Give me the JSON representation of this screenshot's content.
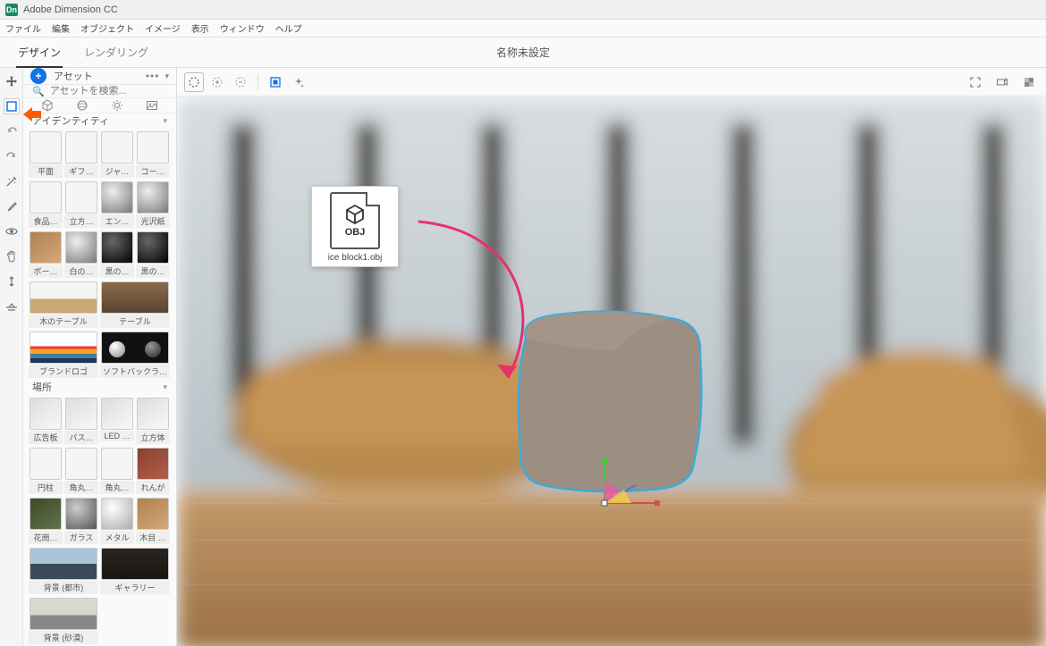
{
  "app": {
    "title": "Adobe Dimension CC",
    "icon_label": "Dn"
  },
  "menubar": [
    "ファイル",
    "編集",
    "オブジェクト",
    "イメージ",
    "表示",
    "ウィンドウ",
    "ヘルプ"
  ],
  "tabs": {
    "design": "デザイン",
    "render": "レンダリング"
  },
  "document_title": "名称未設定",
  "asset_panel": {
    "title": "アセット",
    "search_placeholder": "アセットを検索...",
    "sections": {
      "identity": "アイデンティティ",
      "places": "場所"
    },
    "items_identity": [
      {
        "label": "平面"
      },
      {
        "label": "ギフ…"
      },
      {
        "label": "ジャ…"
      },
      {
        "label": "コー…"
      },
      {
        "label": "食品…"
      },
      {
        "label": "立方…"
      },
      {
        "label": "エン…"
      },
      {
        "label": "光沢紙"
      },
      {
        "label": "ボー…"
      },
      {
        "label": "白の…"
      },
      {
        "label": "黒の…"
      },
      {
        "label": "黒の…"
      },
      {
        "label": "木のテーブル",
        "wide": true
      },
      {
        "label": "テーブル",
        "wide": true
      },
      {
        "label": "ブランドロゴ",
        "wide": true
      },
      {
        "label": "ソフトバックラ…",
        "wide": true
      }
    ],
    "items_places": [
      {
        "label": "広告板"
      },
      {
        "label": "バス…"
      },
      {
        "label": "LED …"
      },
      {
        "label": "立方体"
      },
      {
        "label": "円柱"
      },
      {
        "label": "角丸…"
      },
      {
        "label": "角丸…"
      },
      {
        "label": "れんが"
      },
      {
        "label": "花崗…"
      },
      {
        "label": "ガラス"
      },
      {
        "label": "メタル"
      },
      {
        "label": "木目 …"
      },
      {
        "label": "背景 (都市)",
        "wide": true
      },
      {
        "label": "ギャラリー",
        "wide": true
      },
      {
        "label": "背景 (砂漠)",
        "wide": true
      }
    ]
  },
  "drag_file": {
    "name": "ice block1.obj",
    "ext": "OBJ"
  }
}
